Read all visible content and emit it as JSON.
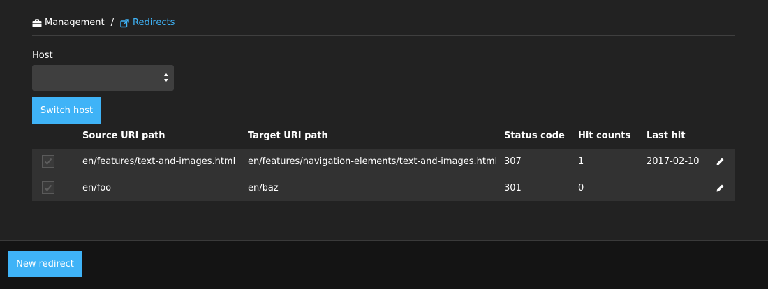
{
  "breadcrumb": {
    "items": [
      {
        "label": "Management",
        "icon": "briefcase-icon"
      },
      {
        "label": "Redirects",
        "icon": "external-link-icon"
      }
    ],
    "separator": "/"
  },
  "host_form": {
    "label": "Host",
    "selected_value": "",
    "switch_button_label": "Switch host"
  },
  "table": {
    "headers": [
      "Source URI path",
      "Target URI path",
      "Status code",
      "Hit counts",
      "Last hit"
    ],
    "rows": [
      {
        "checked": true,
        "source": "en/features/text-and-images.html",
        "target": "en/features/navigation-elements/text-and-images.html",
        "status": "307",
        "hits": "1",
        "last_hit": "2017-02-10"
      },
      {
        "checked": true,
        "source": "en/foo",
        "target": "en/baz",
        "status": "301",
        "hits": "0",
        "last_hit": ""
      }
    ]
  },
  "footer": {
    "new_redirect_label": "New redirect"
  },
  "colors": {
    "accent": "#3fb3f7",
    "background": "#222222",
    "row_background": "#323232",
    "footer_background": "#141414"
  }
}
